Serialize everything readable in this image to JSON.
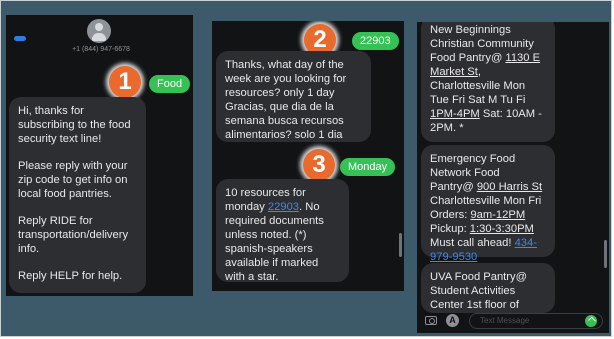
{
  "screen1": {
    "phone_number": "+1 (844) 947-6678",
    "badge": "1",
    "outgoing": "Food",
    "incoming": [
      "Hi, thanks for subscribing to the food security text line!",
      "Please reply with your zip code to get info on local food pantries.",
      "Reply RIDE for transportation/delivery info.",
      "Reply HELP for help."
    ]
  },
  "screen2": {
    "badge_top": "2",
    "outgoing_zip": "22903",
    "incoming_1": "Thanks, what day of the week are you looking for resources? only 1 day Gracias, que dia de la semana busca recursos alimentarios? solo 1 dia",
    "badge_bottom": "3",
    "outgoing_day": "Monday",
    "incoming_2": {
      "pre": "10 resources for monday ",
      "zip_link": "22903",
      "post": ". No required documents unless noted. (*) spanish-speakers available if marked with a star."
    }
  },
  "screen3": {
    "pantry1": {
      "line1": "New Beginnings Christian Community Food Pantry@ ",
      "address": "1130 E Market St",
      "line2": ", Charlottesville Mon Tue Fri Sat M Tu Fi ",
      "hours": "1PM-4PM",
      "line3": " Sat: 10AM - 2PM. *"
    },
    "pantry2": {
      "line1": "Emergency Food Network Food Pantry@ ",
      "address": "900 Harris St",
      "line2": " Charlottesville Mon Fri Orders: ",
      "orders": "9am-12PM",
      "line3": " Pickup: ",
      "pickup": "1:30-3:30PM",
      "line4": " Must call ahead! ",
      "phone": "434-979-9530"
    },
    "pantry3": "UVA Food Pantry@ Student Activities Center 1st floor of",
    "compose_placeholder": "Text Message",
    "apps_glyph": "A"
  },
  "colors": {
    "frame_bg": "#3d5a6b",
    "screen_bg": "#111315",
    "incoming_bubble": "#2c2e31",
    "outgoing_bubble": "#36c155",
    "badge": "#ea6a2d",
    "link": "#3b8af7"
  },
  "icons": [
    "contact-avatar-icon",
    "camera-icon",
    "app-store-icon",
    "send-icon"
  ]
}
